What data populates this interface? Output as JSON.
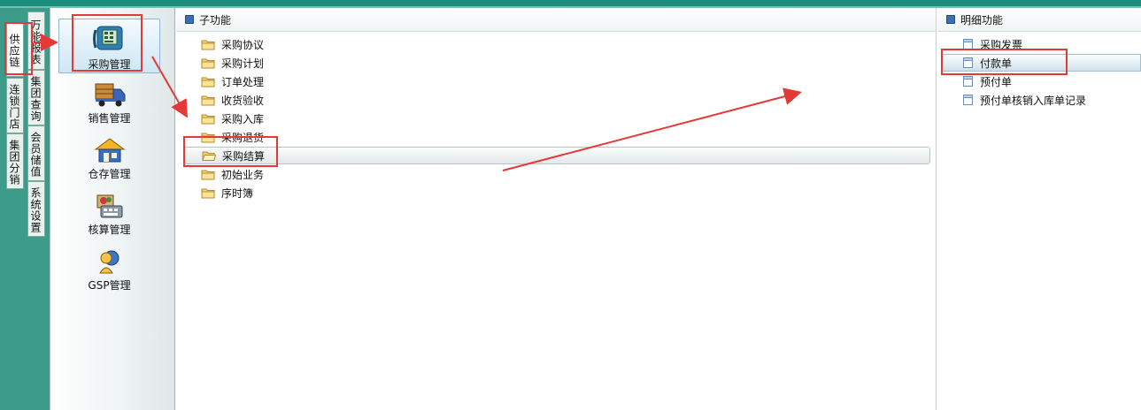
{
  "left_tabs": [
    {
      "label": "供应链",
      "selected": true
    },
    {
      "label": "万能报表",
      "selected": false
    },
    {
      "label": "连锁门店",
      "selected": false
    },
    {
      "label": "集团查询",
      "selected": false
    },
    {
      "label": "集团分销",
      "selected": false
    },
    {
      "label": "会员储值",
      "selected": false
    },
    {
      "label": "系统设置",
      "selected": false
    }
  ],
  "modules": [
    {
      "label": "采购管理",
      "icon": "purchase-phone-icon",
      "selected": true
    },
    {
      "label": "销售管理",
      "icon": "delivery-truck-icon",
      "selected": false
    },
    {
      "label": "仓存管理",
      "icon": "warehouse-house-icon",
      "selected": false
    },
    {
      "label": "核算管理",
      "icon": "calculator-icon",
      "selected": false
    },
    {
      "label": "GSP管理",
      "icon": "gsp-person-icon",
      "selected": false
    }
  ],
  "sub_panel": {
    "title": "子功能",
    "items": [
      "采购协议",
      "采购计划",
      "订单处理",
      "收货验收",
      "采购入库",
      "采购退货",
      "采购结算",
      "初始业务",
      "序时簿"
    ],
    "selected_item": "采购结算"
  },
  "detail_panel": {
    "title": "明细功能",
    "items": [
      "采购发票",
      "付款单",
      "预付单",
      "预付单核销入库单记录"
    ],
    "selected_item": "付款单"
  },
  "colors": {
    "header_teal": "#1c8e7b",
    "annotation_red": "#e53935"
  }
}
